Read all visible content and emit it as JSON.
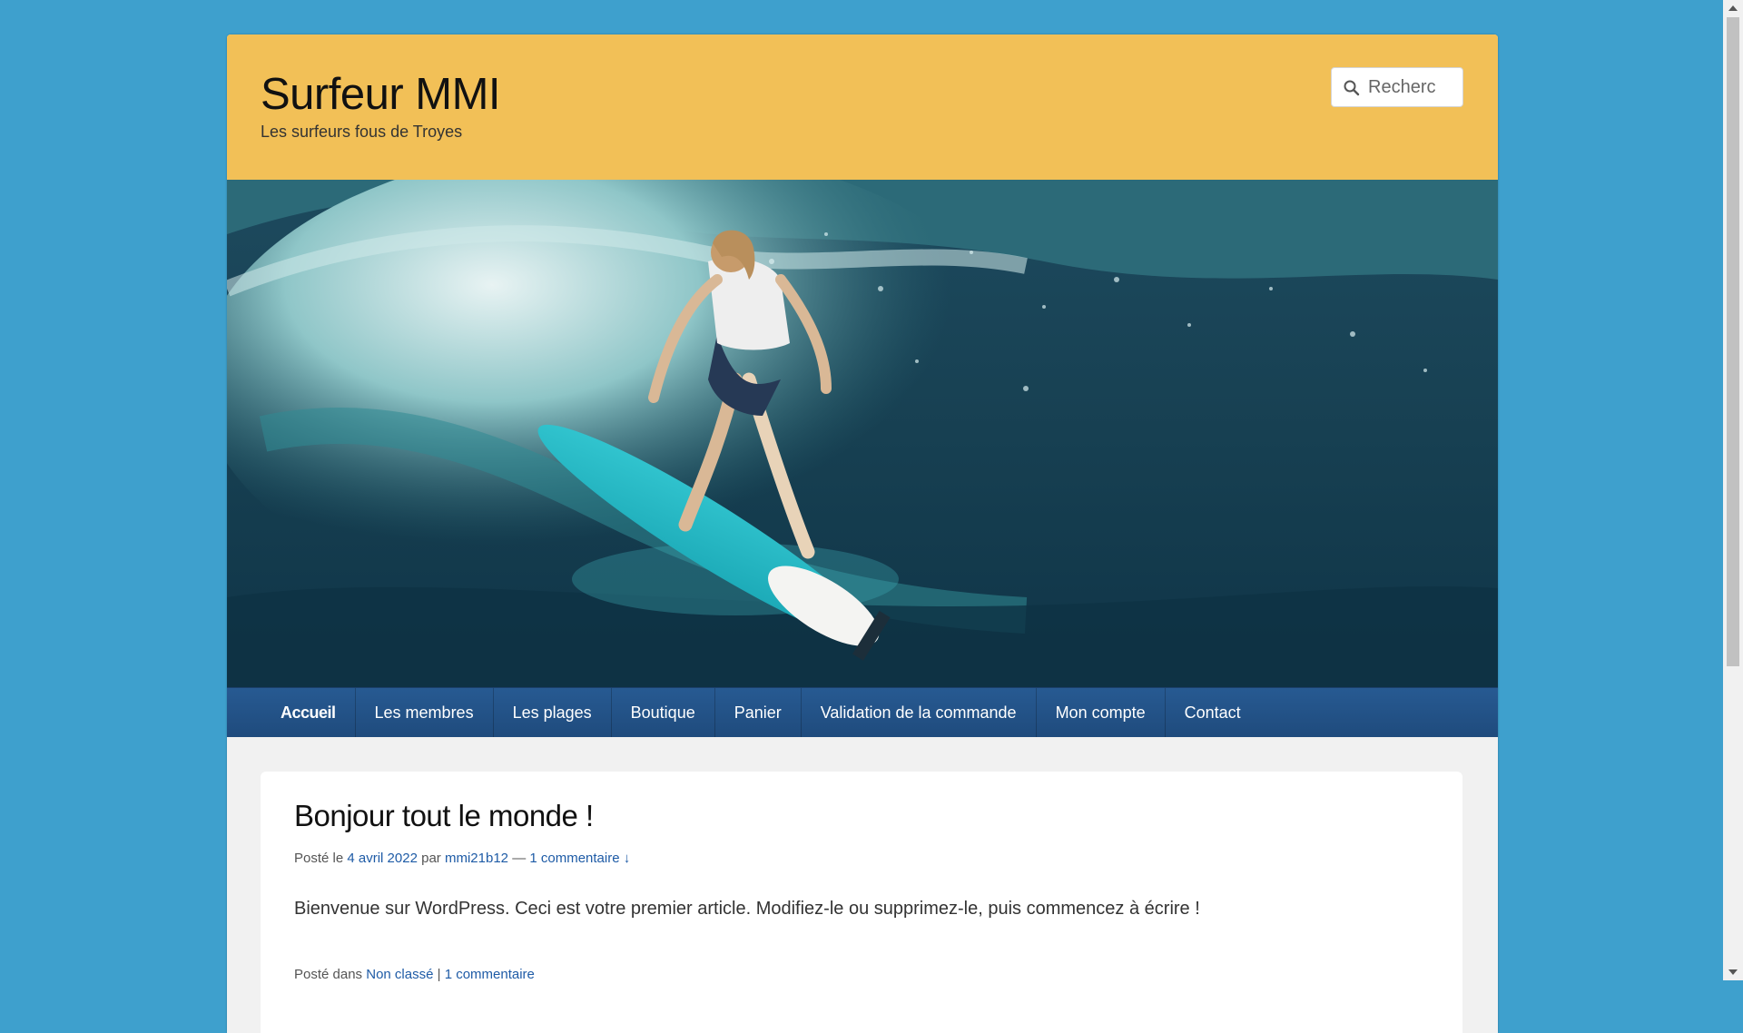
{
  "header": {
    "site_title": "Surfeur MMI",
    "tagline": "Les surfeurs fous de Troyes",
    "search_placeholder": "Recherc",
    "search_icon": "search-icon"
  },
  "hero": {
    "image": "surfer-on-turquoise-surfboard-riding-wave"
  },
  "nav": {
    "items": [
      {
        "label": "Accueil",
        "active": true
      },
      {
        "label": "Les membres"
      },
      {
        "label": "Les plages"
      },
      {
        "label": "Boutique"
      },
      {
        "label": "Panier"
      },
      {
        "label": "Validation de la commande"
      },
      {
        "label": "Mon compte"
      },
      {
        "label": "Contact"
      }
    ]
  },
  "post": {
    "title": "Bonjour tout le monde !",
    "meta": {
      "posted_on": "Posté le",
      "date": "4 avril 2022",
      "by": "par",
      "author": "mmi21b12",
      "dash": "—",
      "comments": "1 commentaire ↓"
    },
    "content": "Bienvenue sur WordPress. Ceci est votre premier article. Modifiez-le ou supprimez-le, puis commencez à écrire !",
    "footer": {
      "posted_in": "Posté dans",
      "category": "Non classé",
      "separator": "|",
      "comments": "1 commentaire"
    }
  },
  "colors": {
    "background": "#3ea0cd",
    "header": "#f2c057",
    "nav": "#275a92",
    "link": "#1e5ba6"
  }
}
